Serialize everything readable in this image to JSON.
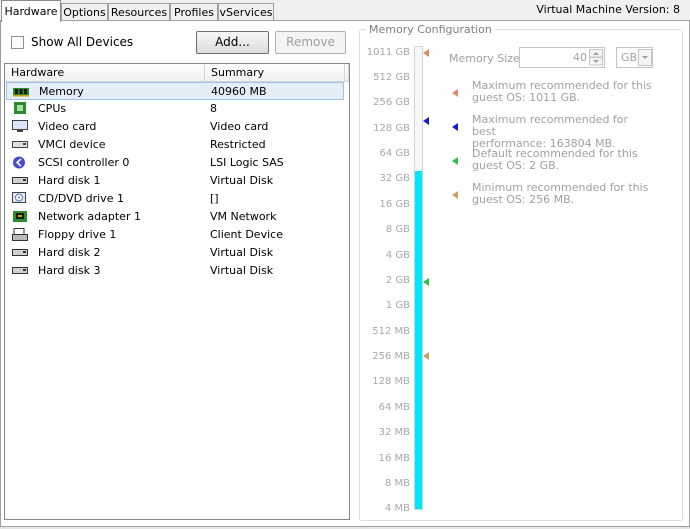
{
  "tabs": [
    {
      "label": "Hardware",
      "active": true
    },
    {
      "label": "Options"
    },
    {
      "label": "Resources"
    },
    {
      "label": "Profiles"
    },
    {
      "label": "vServices"
    }
  ],
  "version": "Virtual Machine Version: 8",
  "toolbar": {
    "show_all_label": "Show All Devices",
    "add_label": "Add...",
    "remove_label": "Remove"
  },
  "list": {
    "headers": [
      "Hardware",
      "Summary"
    ],
    "rows": [
      {
        "name": "Memory",
        "summary": "40960 MB",
        "icon": "memory-icon",
        "selected": true
      },
      {
        "name": "CPUs",
        "summary": "8",
        "icon": "cpu-icon"
      },
      {
        "name": "Video card",
        "summary": "Video card",
        "icon": "monitor-icon"
      },
      {
        "name": "VMCI device",
        "summary": "Restricted",
        "icon": "device-icon"
      },
      {
        "name": "SCSI controller 0",
        "summary": "LSI Logic SAS",
        "icon": "scsi-icon"
      },
      {
        "name": "Hard disk 1",
        "summary": "Virtual Disk",
        "icon": "disk-icon"
      },
      {
        "name": "CD/DVD drive 1",
        "summary": "[]",
        "icon": "cdrom-icon"
      },
      {
        "name": "Network adapter 1",
        "summary": "VM Network",
        "icon": "network-icon"
      },
      {
        "name": "Floppy drive 1",
        "summary": "Client Device",
        "icon": "floppy-icon"
      },
      {
        "name": "Hard disk 2",
        "summary": "Virtual Disk",
        "icon": "disk-icon"
      },
      {
        "name": "Hard disk 3",
        "summary": "Virtual Disk",
        "icon": "disk-icon"
      }
    ]
  },
  "memory": {
    "title": "Memory Configuration",
    "size_label": "Memory Size:",
    "size_value": "40",
    "unit": "GB",
    "scale": [
      "1011 GB",
      "512 GB",
      "256 GB",
      "128 GB",
      "64 GB",
      "32 GB",
      "16 GB",
      "8 GB",
      "4 GB",
      "2 GB",
      "1 GB",
      "512 MB",
      "256 MB",
      "128 MB",
      "64 MB",
      "32 MB",
      "16 MB",
      "8 MB",
      "4 MB"
    ],
    "legend": [
      {
        "line1": "Maximum recommended for this",
        "line2": "guest OS: 1011 GB.",
        "color": "#e08a6a"
      },
      {
        "line1": "Maximum recommended for best",
        "line2": "performance: 163804 MB.",
        "color": "#1a1acc"
      },
      {
        "line1": "Default recommended for this",
        "line2": "guest OS: 2 GB.",
        "color": "#2ec04a"
      },
      {
        "line1": "Minimum recommended for this",
        "line2": "guest OS: 256 MB.",
        "color": "#c8a060"
      }
    ]
  }
}
